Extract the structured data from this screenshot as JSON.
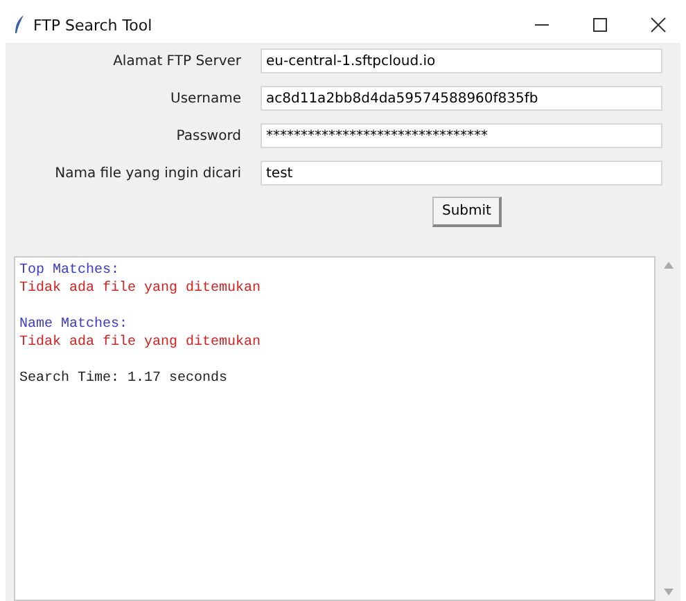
{
  "window": {
    "title": "FTP Search Tool"
  },
  "fields": [
    {
      "label": "Alamat FTP Server",
      "value": "eu-central-1.sftpcloud.io"
    },
    {
      "label": "Username",
      "value": "ac8d11a2bb8d4da59574588960f835fb"
    },
    {
      "label": "Password",
      "value": "********************************"
    },
    {
      "label": "Nama file yang ingin dicari",
      "value": "test"
    }
  ],
  "submit": "Submit",
  "output": [
    {
      "kind": "heading",
      "text": "Top Matches:"
    },
    {
      "kind": "error",
      "text": "Tidak ada file yang ditemukan"
    },
    {
      "kind": "blank"
    },
    {
      "kind": "heading",
      "text": "Name Matches:"
    },
    {
      "kind": "error",
      "text": "Tidak ada file yang ditemukan"
    },
    {
      "kind": "blank"
    },
    {
      "kind": "plain",
      "text": "Search Time: 1.17 seconds"
    }
  ]
}
